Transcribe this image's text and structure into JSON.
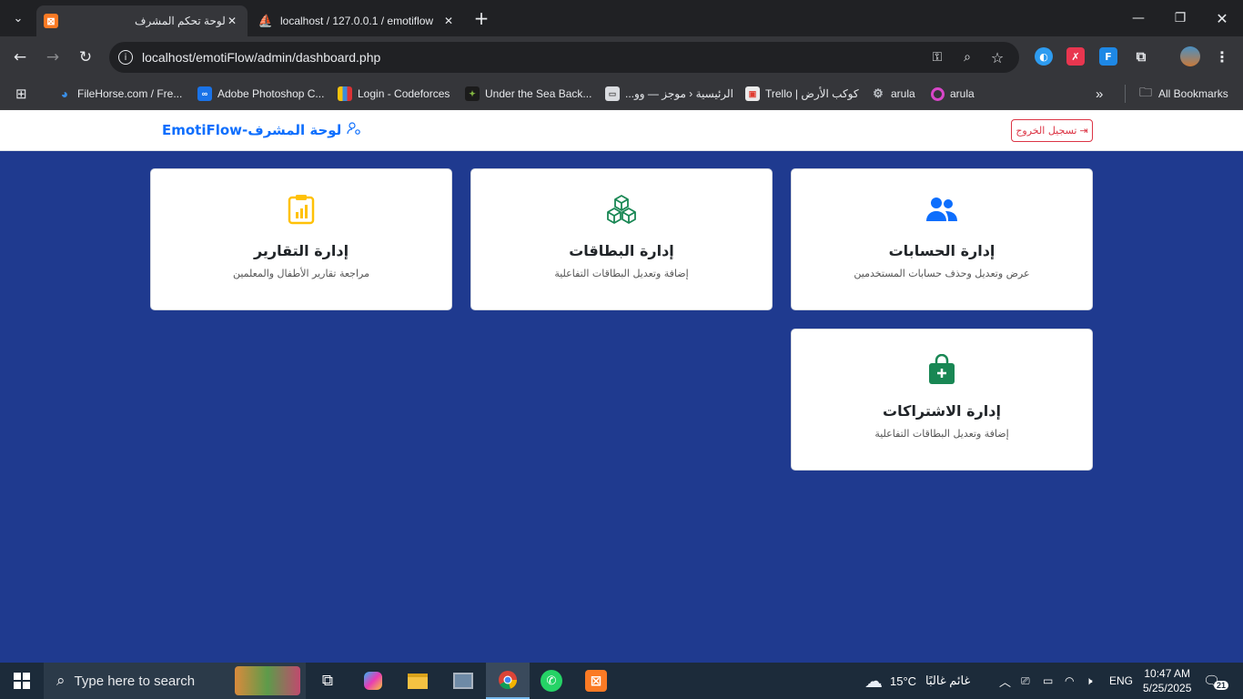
{
  "browser": {
    "tabs": [
      {
        "title": "لوحة تحكم المشرف",
        "active": true
      },
      {
        "title": "localhost / 127.0.0.1 / emotiflow",
        "active": false
      }
    ],
    "url": "localhost/emotiFlow/admin/dashboard.php",
    "bookmarks": [
      {
        "label": "FileHorse.com / Fre...",
        "icon": "filehorse-icon"
      },
      {
        "label": "Adobe Photoshop C...",
        "icon": "link-icon"
      },
      {
        "label": "Login - Codeforces",
        "icon": "codeforces-icon"
      },
      {
        "label": "Under the Sea Back...",
        "icon": "envato-icon"
      },
      {
        "label": "الرئيسية ‹ موجز — وو...",
        "icon": "page-icon"
      },
      {
        "label": "Trello | كوكب الأرض",
        "icon": "trello-icon"
      },
      {
        "label": "arula",
        "icon": "gear-icon"
      },
      {
        "label": "arula",
        "icon": "ring-icon"
      }
    ],
    "all_bookmarks": "All Bookmarks"
  },
  "app": {
    "brand": "لوحة المشرف-EmotiFlow",
    "logout": "تسجيل الخروج",
    "cards": [
      {
        "title": "إدارة الحسابات",
        "desc": "عرض وتعديل وحذف حسابات المستخدمين",
        "icon": "users-icon",
        "color": "#0d6efd"
      },
      {
        "title": "إدارة البطاقات",
        "desc": "إضافة وتعديل البطاقات التفاعلية",
        "icon": "boxes-icon",
        "color": "#198754"
      },
      {
        "title": "إدارة التقارير",
        "desc": "مراجعة تقارير الأطفال والمعلمين",
        "icon": "clipboard-chart-icon",
        "color": "#ffc107"
      },
      {
        "title": "إدارة الاشتراكات",
        "desc": "إضافة وتعديل البطاقات التفاعلية",
        "icon": "bag-plus-icon",
        "color": "#198754"
      }
    ],
    "background_color": "#1f3a8f"
  },
  "taskbar": {
    "search_placeholder": "Type here to search",
    "weather_temp": "15°C",
    "weather_text": "غائم غالبًا",
    "language": "ENG",
    "time": "10:47 AM",
    "date": "5/25/2025",
    "notifications": "21"
  }
}
